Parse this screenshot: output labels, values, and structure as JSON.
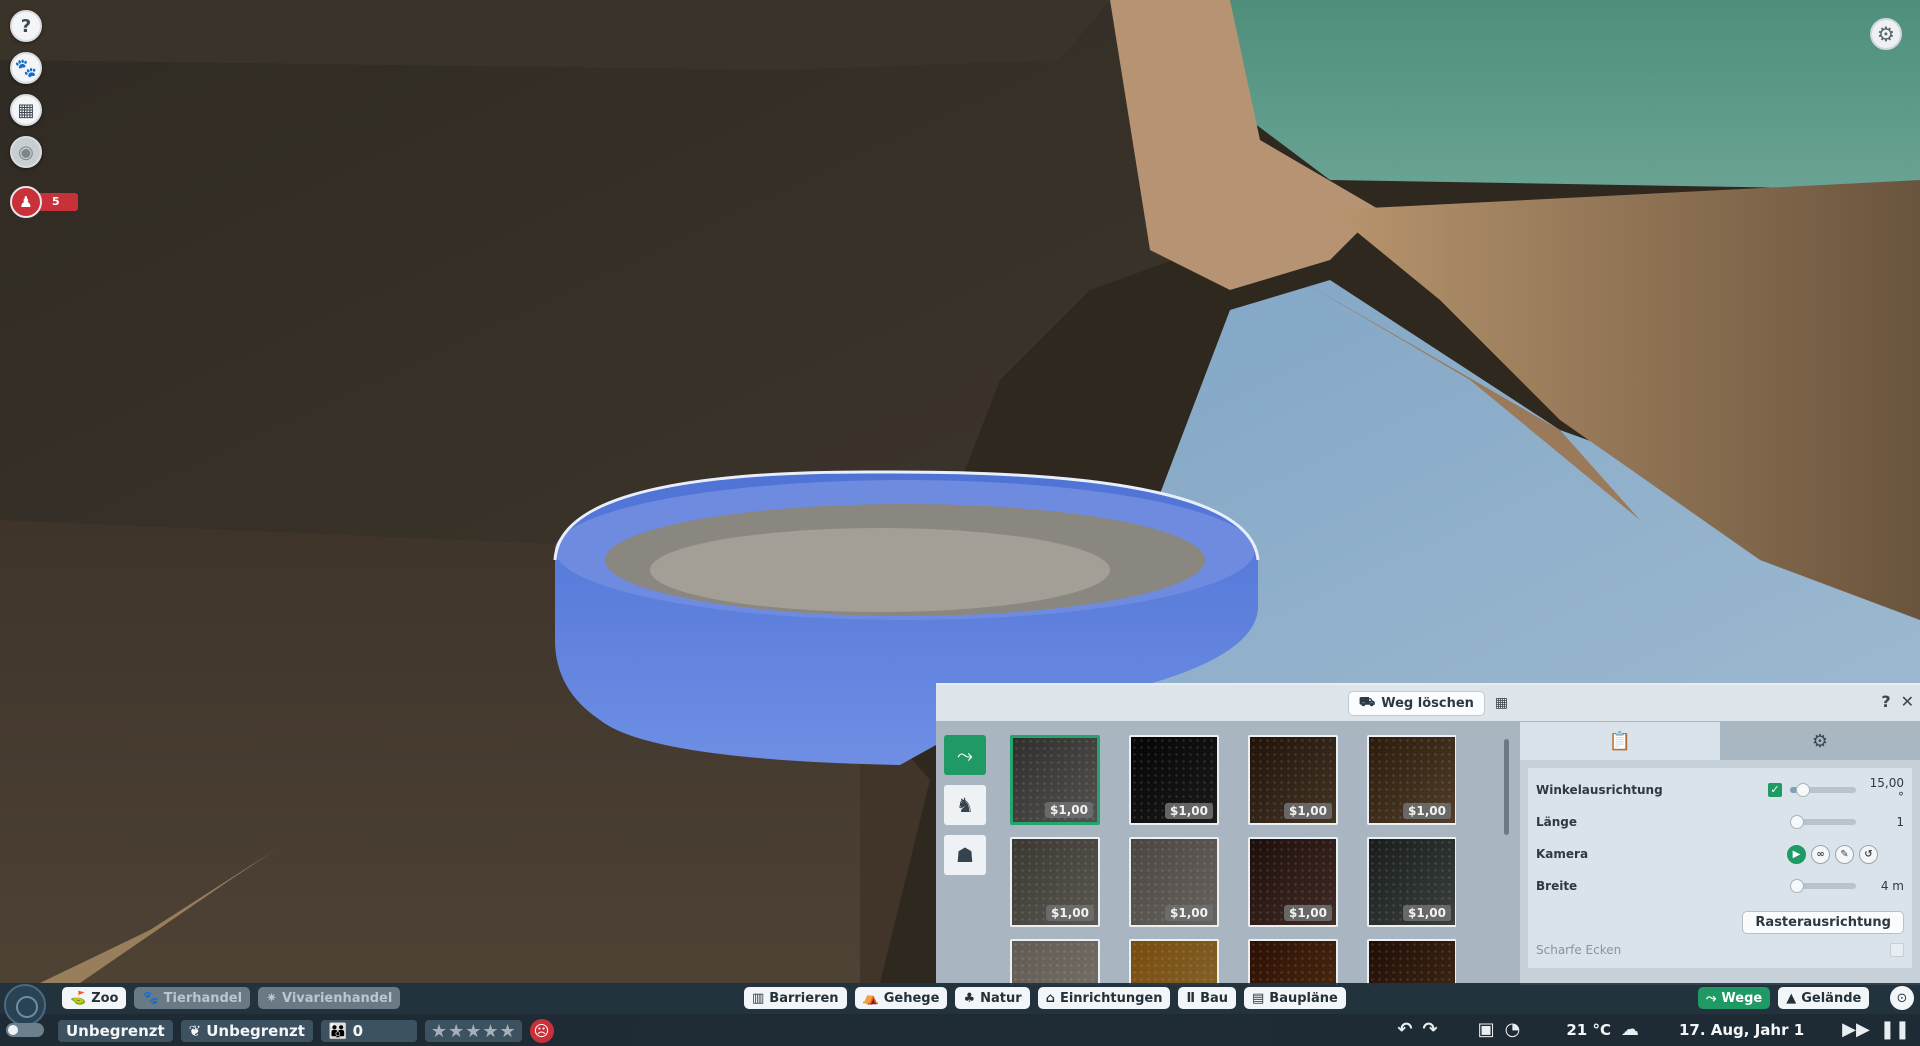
{
  "left_hud": {
    "help_icon": "?",
    "alerts_count": "5"
  },
  "panel": {
    "delete_path_label": "Weg löschen",
    "help_icon": "?",
    "close_icon": "✕",
    "tiles": [
      {
        "price": "$1,00",
        "color": "#6e6d6a"
      },
      {
        "price": "$1,00",
        "color": "#242424"
      },
      {
        "price": "$1,00",
        "color": "#5b4631"
      },
      {
        "price": "$1,00",
        "color": "#6b5338"
      },
      {
        "price": "$1,00",
        "color": "#7a766f"
      },
      {
        "price": "$1,00",
        "color": "#8a8580"
      },
      {
        "price": "$1,00",
        "color": "#573b33"
      },
      {
        "price": "$1,00",
        "color": "#4f5655"
      },
      {
        "price": "",
        "color": "#9e9890"
      },
      {
        "price": "",
        "color": "#b08a3e"
      },
      {
        "price": "",
        "color": "#6a3e1c"
      },
      {
        "price": "",
        "color": "#5a3a22"
      }
    ],
    "props": {
      "angle_label": "Winkelausrichtung",
      "angle_value": "15,00 °",
      "angle_fraction": 0.12,
      "length_label": "Länge",
      "length_value": "1",
      "length_fraction": 0.0,
      "camera_label": "Kamera",
      "width_label": "Breite",
      "width_value": "4 m",
      "width_fraction": 0.0,
      "grid_align_label": "Rasterausrichtung",
      "sharp_corners_label": "Scharfe Ecken"
    }
  },
  "bottom_bar": {
    "tab_zoo": "Zoo",
    "tab_animal_trade": "Tierhandel",
    "tab_vivarium_trade": "Vivarienhandel",
    "tab_barriers": "Barrieren",
    "tab_habitats": "Gehege",
    "tab_nature": "Natur",
    "tab_facilities": "Einrichtungen",
    "tab_construction": "Bau",
    "tab_blueprints": "Baupläne",
    "tab_paths": "Wege",
    "tab_terrain": "Gelände",
    "money": "Unbegrenzt",
    "research": "Unbegrenzt",
    "guests": "0",
    "temperature": "21 °C",
    "date": "17. Aug, Jahr 1",
    "rating_stars": 0
  }
}
